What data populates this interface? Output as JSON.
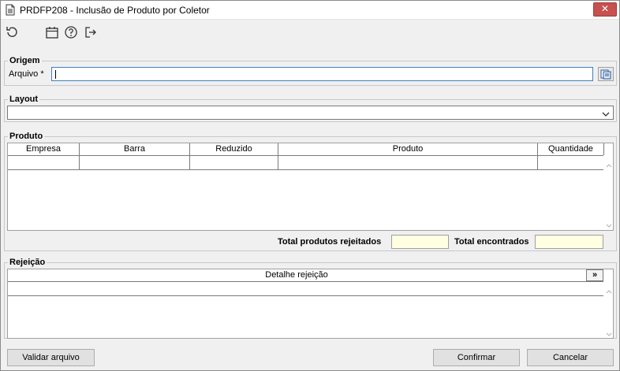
{
  "window": {
    "title": "PRDFP208 - Inclusão de Produto por Coletor",
    "close_label": "✕"
  },
  "toolbar": {
    "icons": [
      "undo-icon",
      "calendar-icon",
      "help-icon",
      "exit-icon"
    ]
  },
  "origem": {
    "legend": "Origem",
    "arquivo_label": "Arquivo *",
    "arquivo_value": ""
  },
  "layout": {
    "legend": "Layout",
    "selected": ""
  },
  "produto": {
    "legend": "Produto",
    "columns": [
      "Empresa",
      "Barra",
      "Reduzido",
      "Produto",
      "Quantidade"
    ],
    "rows": [],
    "total_rejeitados_label": "Total produtos rejeitados",
    "total_rejeitados_value": "",
    "total_encontrados_label": "Total encontrados",
    "total_encontrados_value": ""
  },
  "rejeicao": {
    "legend": "Rejeição",
    "column": "Detalhe rejeição",
    "expand_label": "»"
  },
  "footer": {
    "validar_label": "Validar arquivo",
    "confirmar_label": "Confirmar",
    "cancelar_label": "Cancelar"
  },
  "colors": {
    "close_button": "#c75050",
    "total_field_bg": "#ffffe1",
    "focus_border": "#3f7fbf"
  }
}
